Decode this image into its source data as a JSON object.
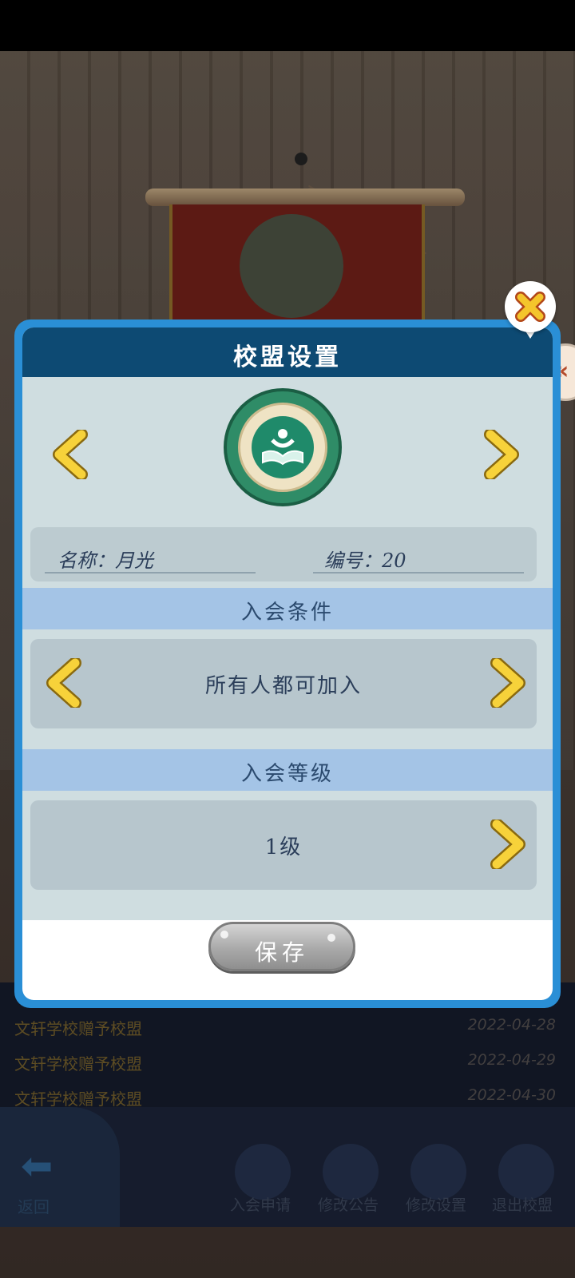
{
  "dialog": {
    "title": "校盟设置",
    "name_label": "名称：月光",
    "number_label": "编号：20",
    "join_condition": {
      "title": "入会条件",
      "value": "所有人都可加入"
    },
    "join_level": {
      "title": "入会等级",
      "value": "1级"
    },
    "save_label": "保存"
  },
  "records": [
    {
      "text": "文轩学校赠予校盟",
      "date": "2022-04-28"
    },
    {
      "text": "文轩学校赠予校盟",
      "date": "2022-04-29"
    },
    {
      "text": "文轩学校赠予校盟",
      "date": "2022-04-30"
    }
  ],
  "bottom_nav": {
    "back": "返回",
    "items": [
      "入会申请",
      "修改公告",
      "修改设置",
      "退出校盟"
    ]
  },
  "side_tab": "«",
  "colors": {
    "dialog_border": "#2a8fd6",
    "header": "#0d4a73",
    "section_bar": "#a4c4e6",
    "chevron": "#f7d23a"
  },
  "icons": [
    "close-icon",
    "chevron-left-icon",
    "chevron-right-icon",
    "league-emblem-icon",
    "back-arrow-icon"
  ]
}
